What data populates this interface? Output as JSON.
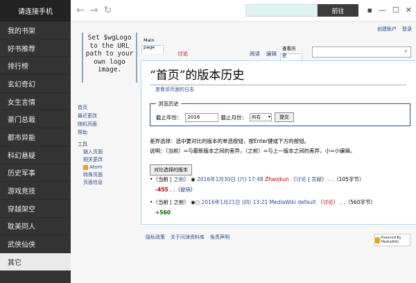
{
  "sidebar": {
    "title": "请连接手机",
    "items": [
      "我的书架",
      "好书推荐",
      "排行榜",
      "玄幻奇幻",
      "女生言情",
      "豪门总裁",
      "都市异能",
      "科幻悬疑",
      "历史军事",
      "游戏竞技",
      "穿越架空",
      "耽美同人",
      "武侠仙侠",
      "其它"
    ]
  },
  "browser": {
    "go_label": "前往"
  },
  "wiki": {
    "logo_text": "Set $wgLogo to the URL path to your own logo image.",
    "user_nav": [
      "创建账户",
      "登录"
    ],
    "tabs": {
      "main_page": "Main page",
      "talk": "讨论",
      "read": "阅读",
      "edit": "编辑",
      "history": "查看历史"
    },
    "title": "“首页”的版本历史",
    "view_log": "查看该页面的日志",
    "browse": {
      "legend": "浏览历史",
      "year_label": "截止年份：",
      "year_value": "2016",
      "month_label": "截止月份：",
      "month_value": "所有",
      "submit": "提交"
    },
    "diff_note": "差异选择：选中要对比的版本的单选按钮，按Enter键或下方的按钮。",
    "legend_note": "说明：（当前）=与最新版本之间的差异，（之前）=与上一版本之间的差异，小=小编辑。",
    "compare_button": "对比选择的版本",
    "history": [
      {
        "cur": "当前",
        "prev": "之前",
        "date": "2016年1月30日 (六) 17:48",
        "user": "Zhaojkun",
        "talk": "讨论",
        "contrib": "贡献",
        "size": "105字节",
        "change": "-455",
        "undo": "撤销"
      },
      {
        "cur": "当前",
        "prev": "之前",
        "date": "2016年1月21日 (四) 13:21",
        "user": "MediaWiki default",
        "talk": "讨论",
        "size": "560字节",
        "change": "+560"
      }
    ],
    "nav": [
      "首页",
      "最近更改",
      "随机页面",
      "帮助"
    ],
    "tools_heading": "工具",
    "tools": [
      "链入页面",
      "相关更改",
      "Atom",
      "特殊页面",
      "页面信息"
    ],
    "footer": [
      "隐私政策",
      "关于问津资料库",
      "免责声明"
    ],
    "badge": "Powered By MediaWiki"
  }
}
